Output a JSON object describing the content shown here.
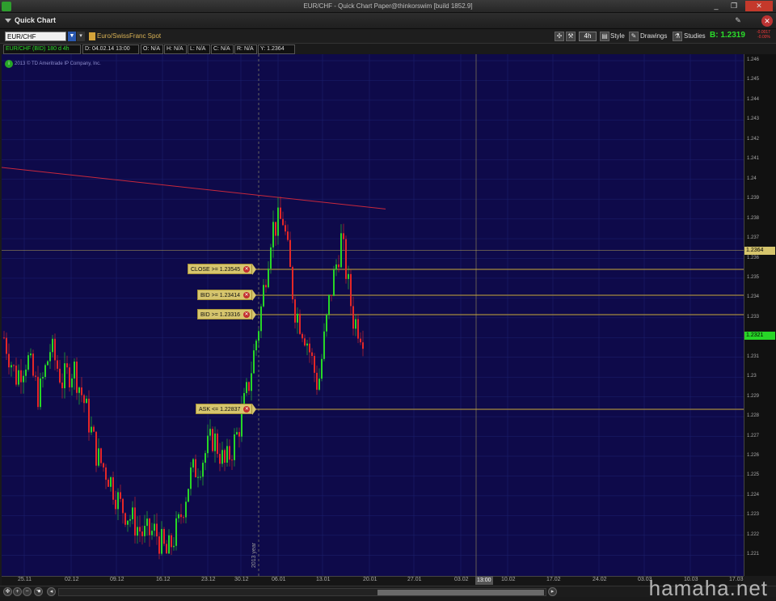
{
  "window": {
    "title": "EUR/CHF - Quick Chart Paper@thinkorswim [build 1852.9]",
    "controls": [
      "_",
      "❐",
      "✕"
    ]
  },
  "panel": {
    "title": "Quick Chart"
  },
  "toolbar": {
    "symbol": "EUR/CHF",
    "description": "Euro/SwissFranc Spot",
    "aggregation": "4h",
    "style_label": "Style",
    "drawings_label": "Drawings",
    "studies_label": "Studies",
    "bid_label": "B: 1.2319",
    "bid_change": "-0.0017",
    "bid_change_pct": "-0.00%"
  },
  "info": {
    "symbol": "EUR/CHF (BID) 180 d 4h",
    "date": "D: 04.02.14 13:00",
    "open": "O: N/A",
    "high": "H: N/A",
    "low": "L: N/A",
    "close": "C: N/A",
    "range": "R: N/A",
    "y": "Y: 1.2364"
  },
  "copyright": "2013 © TD Ameritrade IP Company, Inc.",
  "colors": {
    "background": "#0e0a4a",
    "up": "#27d627",
    "down": "#e42727",
    "alert_line": "#c9a93a",
    "trendline": "#c8283c",
    "grid": "#1d2270"
  },
  "chart_data": {
    "type": "candlestick",
    "instrument": "EUR/CHF",
    "yticks": [
      "1.246",
      "1.245",
      "1.244",
      "1.243",
      "1.242",
      "1.241",
      "1.24",
      "1.239",
      "1.238",
      "1.237",
      "1.236",
      "1.235",
      "1.234",
      "1.233",
      "1.232",
      "1.231",
      "1.23",
      "1.229",
      "1.228",
      "1.227",
      "1.226",
      "1.225",
      "1.224",
      "1.223",
      "1.222",
      "1.221"
    ],
    "ylim": [
      1.2205,
      1.2463
    ],
    "xticks": [
      "25.11",
      "02.12",
      "09.12",
      "16.12",
      "23.12",
      "30.12",
      "06.01",
      "13.01",
      "20.01",
      "27.01",
      "03.02",
      "10.02",
      "17.02",
      "24.02",
      "03.03",
      "10.03",
      "17.03"
    ],
    "cursor_x_label": "13:00",
    "cursor_y_label": "1.2364",
    "last_price_label": "1.2321",
    "year_marker": "2013 year",
    "alerts": [
      {
        "label": "CLOSE >= 1.23545",
        "price": 1.23545
      },
      {
        "label": "BID >= 1.23414",
        "price": 1.23414
      },
      {
        "label": "BID >= 1.23316",
        "price": 1.23316
      },
      {
        "label": "ASK <= 1.22837",
        "price": 1.22837
      }
    ],
    "trendline": {
      "from": {
        "date": "21.11",
        "price": 1.2406
      },
      "to": {
        "date": "21.01",
        "price": 1.2385
      }
    },
    "price_path": [
      [
        "21.11",
        1.232
      ],
      [
        "23.11",
        1.23
      ],
      [
        "25.11",
        1.231
      ],
      [
        "27.11",
        1.229
      ],
      [
        "29.11",
        1.2315
      ],
      [
        "01.12",
        1.2298
      ],
      [
        "03.12",
        1.2305
      ],
      [
        "05.12",
        1.2285
      ],
      [
        "07.12",
        1.226
      ],
      [
        "09.12",
        1.225
      ],
      [
        "11.12",
        1.2235
      ],
      [
        "13.12",
        1.2228
      ],
      [
        "15.12",
        1.222
      ],
      [
        "17.12",
        1.2222
      ],
      [
        "19.12",
        1.221
      ],
      [
        "21.12",
        1.2225
      ],
      [
        "23.12",
        1.225
      ],
      [
        "25.12",
        1.2258
      ],
      [
        "27.12",
        1.227
      ],
      [
        "29.12",
        1.2255
      ],
      [
        "31.12",
        1.227
      ],
      [
        "02.01",
        1.2295
      ],
      [
        "04.01",
        1.233
      ],
      [
        "06.01",
        1.2375
      ],
      [
        "08.01",
        1.238
      ],
      [
        "10.01",
        1.2335
      ],
      [
        "12.01",
        1.232
      ],
      [
        "14.01",
        1.2295
      ],
      [
        "16.01",
        1.234
      ],
      [
        "18.01",
        1.237
      ],
      [
        "20.01",
        1.233
      ],
      [
        "21.01",
        1.2321
      ]
    ]
  },
  "watermark": "hamaha.net"
}
